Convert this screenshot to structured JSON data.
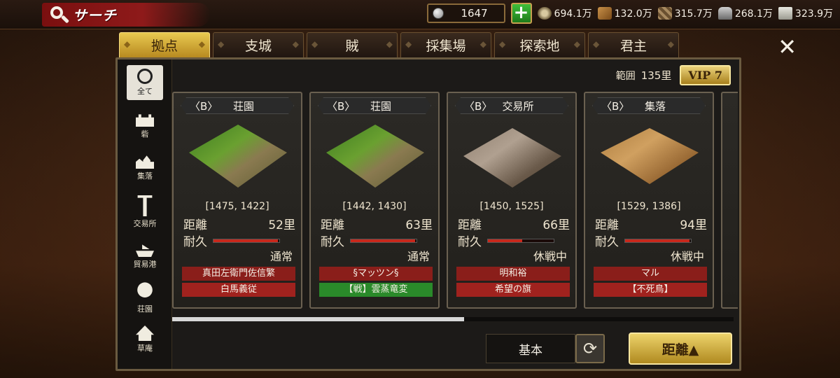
{
  "header": {
    "title": "サーチ",
    "gold": "1647",
    "plus_label": "+",
    "resources": [
      {
        "icon": "money-icon",
        "value": "694.1万"
      },
      {
        "icon": "wood-icon",
        "value": "132.0万"
      },
      {
        "icon": "cloth-icon",
        "value": "315.7万"
      },
      {
        "icon": "iron-icon",
        "value": "268.1万"
      },
      {
        "icon": "rice-icon",
        "value": "323.9万"
      }
    ]
  },
  "tabs": [
    {
      "label": "拠点",
      "active": true
    },
    {
      "label": "支城",
      "active": false
    },
    {
      "label": "賊",
      "active": false
    },
    {
      "label": "採集場",
      "active": false
    },
    {
      "label": "探索地",
      "active": false
    },
    {
      "label": "君主",
      "active": false
    }
  ],
  "close_label": "✕",
  "sidebar": [
    {
      "label": "全て",
      "icon": "all-icon"
    },
    {
      "label": "砦",
      "icon": "fort-icon"
    },
    {
      "label": "集落",
      "icon": "village-icon"
    },
    {
      "label": "交易所",
      "icon": "market-icon"
    },
    {
      "label": "貿易港",
      "icon": "port-icon"
    },
    {
      "label": "荘園",
      "icon": "manor-icon"
    },
    {
      "label": "草庵",
      "icon": "hut-icon"
    }
  ],
  "range": {
    "label": "範囲",
    "value": "135里",
    "vip": "VIP 7"
  },
  "card_labels": {
    "distance": "距離",
    "durability": "耐久"
  },
  "cards": [
    {
      "rank": "〈B〉",
      "type": "荘園",
      "coords": "[1475, 1422]",
      "distance": "52里",
      "durability": 0.98,
      "status": "通常",
      "owner": "真田左衛門佐信繁",
      "owner2": "白馬義従",
      "owner2_green": false
    },
    {
      "rank": "〈B〉",
      "type": "荘園",
      "coords": "[1442, 1430]",
      "distance": "63里",
      "durability": 0.98,
      "status": "通常",
      "owner": "§マッツン§",
      "owner2": "【戦】雲蒸竜変",
      "owner2_green": true
    },
    {
      "rank": "〈B〉",
      "type": "交易所",
      "coords": "[1450, 1525]",
      "distance": "66里",
      "durability": 0.52,
      "status": "休戦中",
      "owner": "明和裕",
      "owner2": "希望の旗",
      "owner2_green": false
    },
    {
      "rank": "〈B〉",
      "type": "集落",
      "coords": "[1529, 1386]",
      "distance": "94里",
      "durability": 0.98,
      "status": "休戦中",
      "owner": "マル",
      "owner2": "【不死鳥】",
      "owner2_green": false
    }
  ],
  "scroll_position": 0.52,
  "footer": {
    "basic": "基本",
    "sort": "距離▲"
  }
}
